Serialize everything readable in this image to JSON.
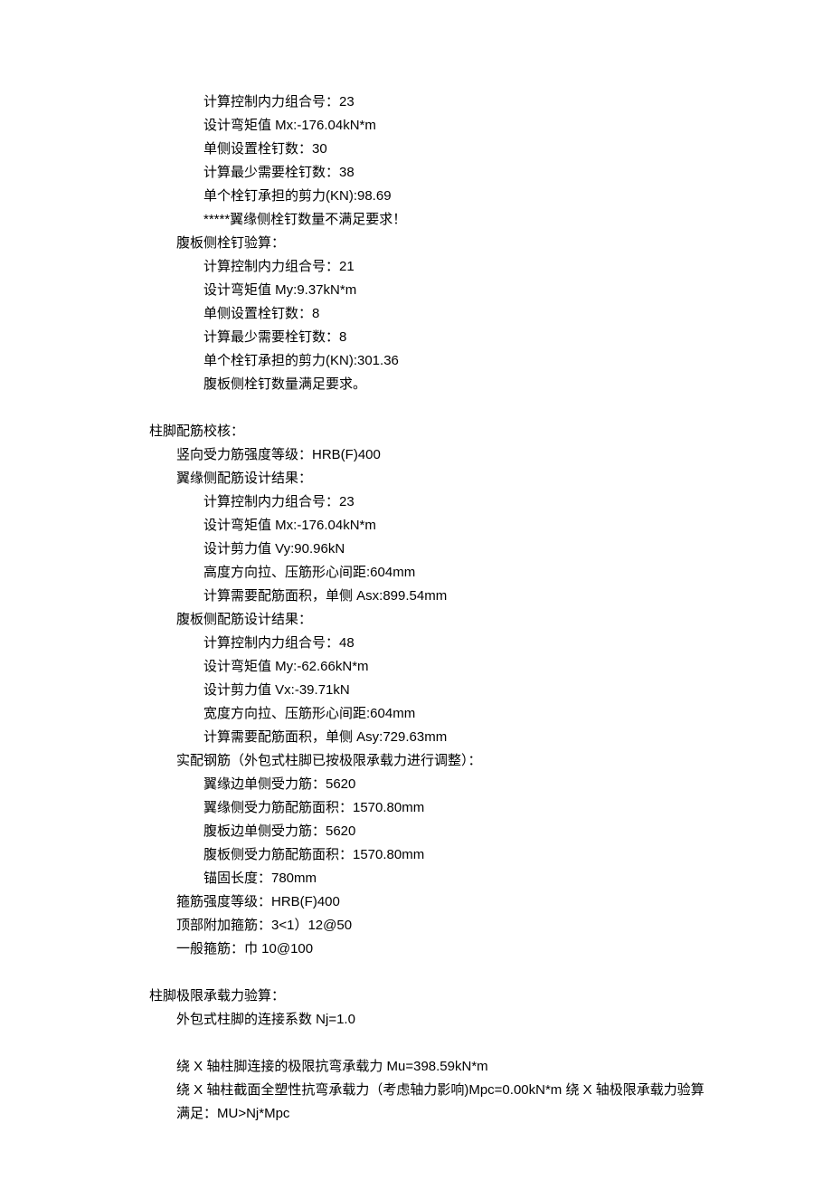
{
  "s1": {
    "l1": "计算控制内力组合号：23",
    "l2": "设计弯矩值 Mx:-176.04kN*m",
    "l3": "单侧设置栓钉数：30",
    "l4": "计算最少需要栓钉数：38",
    "l5": "单个栓钉承担的剪力(KN):98.69",
    "l6": "*****翼缘侧栓钉数量不满足要求！",
    "l7": "腹板侧栓钉验算：",
    "l8": "计算控制内力组合号：21",
    "l9": "设计弯矩值 My:9.37kN*m",
    "l10": "单侧设置栓钉数：8",
    "l11": "计算最少需要栓钉数：8",
    "l12": "单个栓钉承担的剪力(KN):301.36",
    "l13": "腹板侧栓钉数量满足要求。"
  },
  "s2": {
    "h": "柱脚配筋校核：",
    "l1": "竖向受力筋强度等级：HRB(F)400",
    "l2": "翼缘侧配筋设计结果：",
    "l3": "计算控制内力组合号：23",
    "l4": "设计弯矩值 Mx:-176.04kN*m",
    "l5": "设计剪力值 Vy:90.96kN",
    "l6": "高度方向拉、压筋形心间距:604mm",
    "l7": "计算需要配筋面积，单侧 Asx:899.54mm",
    "l8": "腹板侧配筋设计结果：",
    "l9": "计算控制内力组合号：48",
    "l10": "设计弯矩值 My:-62.66kN*m",
    "l11": "设计剪力值 Vx:-39.71kN",
    "l12": "宽度方向拉、压筋形心间距:604mm",
    "l13": "计算需要配筋面积，单侧 Asy:729.63mm",
    "l14": "实配钢筋（外包式柱脚已按极限承载力进行调整）：",
    "l15": "翼缘边单侧受力筋：5620",
    "l16": "翼缘侧受力筋配筋面积：1570.80mm",
    "l17": "腹板边单侧受力筋：5620",
    "l18": "腹板侧受力筋配筋面积：1570.80mm",
    "l19": "锚固长度：780mm",
    "l20": "箍筋强度等级：HRB(F)400",
    "l21": "顶部附加箍筋：3<1）12@50",
    "l22": "一般箍筋：巾 10@100"
  },
  "s3": {
    "h": "柱脚极限承载力验算：",
    "l1": "外包式柱脚的连接系数 Nj=1.0",
    "l2": "绕 X 轴柱脚连接的极限抗弯承载力 Mu=398.59kN*m",
    "l3": "绕 X 轴柱截面全塑性抗弯承载力（考虑轴力影响)Mpc=0.00kN*m 绕 X 轴极限承载力验算",
    "l4": "满足：MU>Nj*Mpc"
  }
}
